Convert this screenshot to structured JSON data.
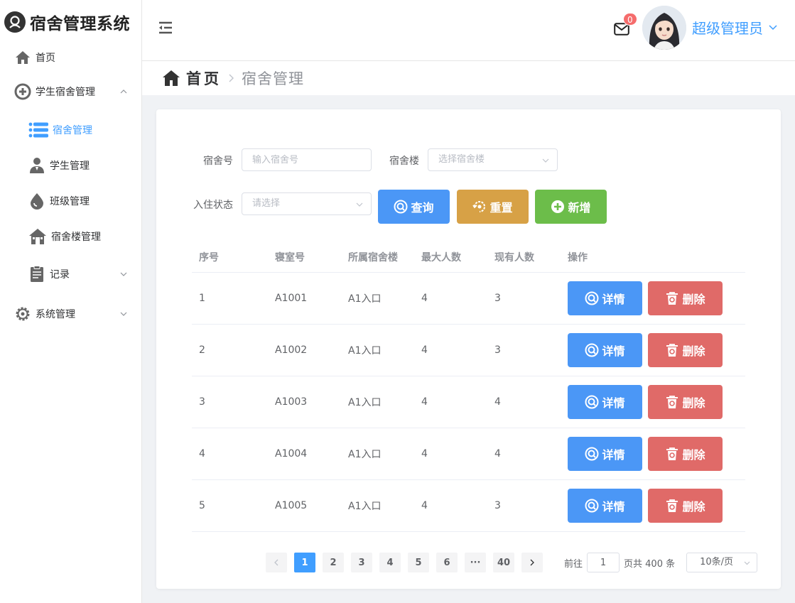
{
  "app": {
    "title": "宿舍管理系统"
  },
  "sidebar": {
    "items": [
      {
        "label": "首页",
        "icon": "home-icon"
      },
      {
        "label": "学生宿舍管理",
        "icon": "plus-circle-icon",
        "expanded": true,
        "children": [
          {
            "label": "宿舍管理",
            "icon": "list-icon",
            "active": true
          },
          {
            "label": "学生管理",
            "icon": "user-icon"
          },
          {
            "label": "班级管理",
            "icon": "drop-icon"
          },
          {
            "label": "宿舍楼管理",
            "icon": "building-icon"
          }
        ]
      },
      {
        "label": "记录",
        "icon": "document-icon",
        "expanded": false
      },
      {
        "label": "系统管理",
        "icon": "gear-icon",
        "expanded": false
      }
    ]
  },
  "header": {
    "notification_count": "0",
    "username": "超级管理员"
  },
  "breadcrumb": {
    "home": "首页",
    "current": "宿舍管理"
  },
  "filters": {
    "room_label": "宿舍号",
    "room_placeholder": "输入宿舍号",
    "building_label": "宿舍楼",
    "building_placeholder": "选择宿舍楼",
    "status_label": "入住状态",
    "status_placeholder": "请选择"
  },
  "buttons": {
    "search": "查询",
    "reset": "重置",
    "add": "新增",
    "detail": "详情",
    "delete": "删除"
  },
  "table": {
    "columns": [
      "序号",
      "寝室号",
      "所属宿舍楼",
      "最大人数",
      "现有人数",
      "操作"
    ],
    "rows": [
      {
        "index": "1",
        "room": "A1001",
        "building": "A1入口",
        "max": "4",
        "current": "3"
      },
      {
        "index": "2",
        "room": "A1002",
        "building": "A1入口",
        "max": "4",
        "current": "3"
      },
      {
        "index": "3",
        "room": "A1003",
        "building": "A1入口",
        "max": "4",
        "current": "4"
      },
      {
        "index": "4",
        "room": "A1004",
        "building": "A1入口",
        "max": "4",
        "current": "4"
      },
      {
        "index": "5",
        "room": "A1005",
        "building": "A1入口",
        "max": "4",
        "current": "3"
      }
    ]
  },
  "pagination": {
    "pages": [
      "1",
      "2",
      "3",
      "4",
      "5",
      "6",
      "···",
      "40"
    ],
    "current": "1",
    "goto_label": "前往",
    "goto_value": "1",
    "total_text": "页共 400 条",
    "page_size": "10条/页"
  },
  "colors": {
    "primary": "#409eff",
    "warning": "#d7a146",
    "success": "#6cbd4a",
    "danger": "#e06a68"
  }
}
